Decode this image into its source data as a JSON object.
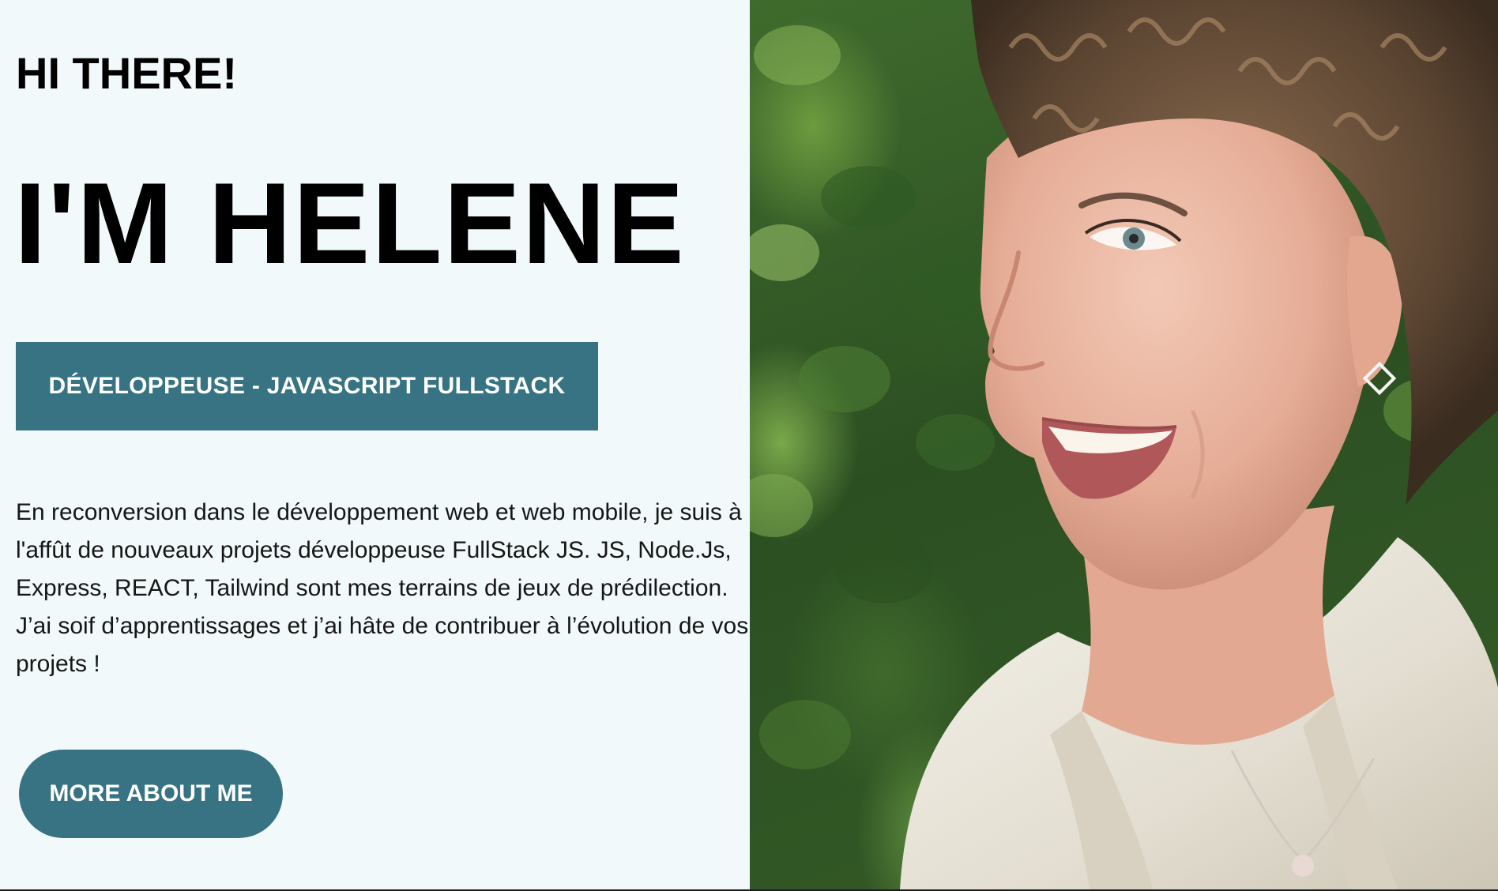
{
  "hero": {
    "greeting": "HI THERE!",
    "name": "I'M HELENE",
    "role": "DÉVELOPPEUSE - JAVASCRIPT FULLSTACK",
    "intro": "En reconversion dans le développement web et web mobile, je suis à l'affût de nouveaux projets développeuse FullStack JS. JS, Node.Js, Express, REACT, Tailwind sont mes terrains de jeux de prédilection. J’ai soif d’apprentissages et j’ai hâte de contribuer à l’évolution de vos projets !",
    "cta_label": "MORE ABOUT ME"
  },
  "colors": {
    "background": "#f1f9fb",
    "accent": "#377383",
    "text": "#000000"
  },
  "photo": {
    "subject": "portrait-photo"
  }
}
